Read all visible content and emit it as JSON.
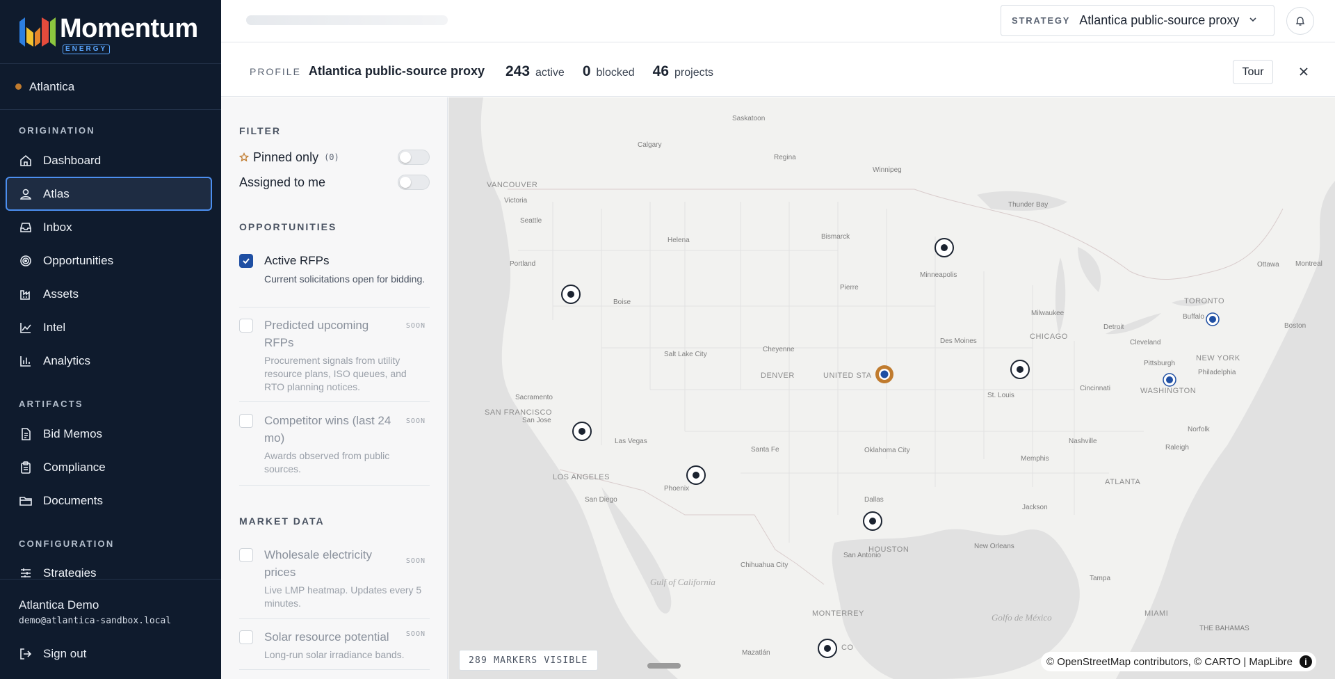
{
  "brand": {
    "name": "Momentum",
    "sub": "ENERGY"
  },
  "org": {
    "name": "Atlantica"
  },
  "nav": {
    "origination_title": "ORIGINATION",
    "origination": [
      {
        "label": "Dashboard",
        "icon": "home-icon"
      },
      {
        "label": "Atlas",
        "icon": "user-pin-icon",
        "active": true
      },
      {
        "label": "Inbox",
        "icon": "inbox-icon"
      },
      {
        "label": "Opportunities",
        "icon": "target-icon"
      },
      {
        "label": "Assets",
        "icon": "factory-icon"
      },
      {
        "label": "Intel",
        "icon": "trend-icon"
      },
      {
        "label": "Analytics",
        "icon": "bar-chart-icon"
      }
    ],
    "artifacts_title": "ARTIFACTS",
    "artifacts": [
      {
        "label": "Bid Memos",
        "icon": "document-icon"
      },
      {
        "label": "Compliance",
        "icon": "clipboard-icon"
      },
      {
        "label": "Documents",
        "icon": "folder-icon"
      }
    ],
    "configuration_title": "CONFIGURATION",
    "configuration": [
      {
        "label": "Strategies",
        "icon": "sliders-icon"
      }
    ]
  },
  "user": {
    "name": "Atlantica Demo",
    "email": "demo@atlantica-sandbox.local",
    "signout": "Sign out"
  },
  "topbar": {
    "strategy_label": "STRATEGY",
    "strategy_value": "Atlantica public-source proxy"
  },
  "profile": {
    "label": "PROFILE",
    "name": "Atlantica public-source proxy",
    "stats": [
      {
        "num": "243",
        "label": "active"
      },
      {
        "num": "0",
        "label": "blocked"
      },
      {
        "num": "46",
        "label": "projects"
      }
    ],
    "tour": "Tour"
  },
  "filter": {
    "title": "FILTER",
    "pinned_label": "Pinned only",
    "pinned_count": "(0)",
    "assigned_label": "Assigned to me"
  },
  "opportunities": {
    "title": "OPPORTUNITIES",
    "items": [
      {
        "title": "Active RFPs",
        "desc": "Current solicitations open for bidding.",
        "checked": true,
        "soon": ""
      },
      {
        "title": "Predicted upcoming RFPs",
        "desc": "Procurement signals from utility resource plans, ISO queues, and RTO planning notices.",
        "checked": false,
        "soon": "SOON"
      },
      {
        "title": "Competitor wins (last 24 mo)",
        "desc": "Awards observed from public sources.",
        "checked": false,
        "soon": "SOON"
      }
    ]
  },
  "market": {
    "title": "MARKET DATA",
    "items": [
      {
        "title": "Wholesale electricity prices",
        "desc": "Live LMP heatmap. Updates every 5 minutes.",
        "soon": "SOON"
      },
      {
        "title": "Solar resource potential",
        "desc": "Long-run solar irradiance bands.",
        "soon": "SOON"
      }
    ]
  },
  "map": {
    "markers_visible": "289 MARKERS VISIBLE",
    "attribution": "© OpenStreetMap contributors, © CARTO | MapLibre",
    "info": "i",
    "labels": {
      "saskatoon": "Saskatoon",
      "calgary": "Calgary",
      "regina": "Regina",
      "winnipeg": "Winnipeg",
      "vancouver": "VANCOUVER",
      "victoria": "Victoria",
      "seattle": "Seattle",
      "portland": "Portland",
      "thunder_bay": "Thunder Bay",
      "helena": "Helena",
      "bismarck": "Bismarck",
      "minneapolis": "Minneapolis",
      "ottawa": "Ottawa",
      "montreal": "Montreal",
      "boise": "Boise",
      "pierre": "Pierre",
      "toronto": "TORONTO",
      "milwaukee": "Milwaukee",
      "buffalo": "Buffalo",
      "boston": "Boston",
      "detroit": "Detroit",
      "chicago": "CHICAGO",
      "cleveland": "Cleveland",
      "des_moines": "Des Moines",
      "new_york": "NEW YORK",
      "salt_lake": "Salt Lake City",
      "cheyenne": "Cheyenne",
      "pittsburgh": "Pittsburgh",
      "philadelphia": "Philadelphia",
      "denver": "DENVER",
      "united_states": "UNITED STA",
      "washington": "WASHINGTON",
      "sacramento": "Sacramento",
      "cincinnati": "Cincinnati",
      "st_louis": "St. Louis",
      "san_francisco": "SAN FRANCISCO",
      "san_jose": "San Jose",
      "norfolk": "Norfolk",
      "las_vegas": "Las Vegas",
      "nashville": "Nashville",
      "santa_fe": "Santa Fe",
      "raleigh": "Raleigh",
      "oklahoma_city": "Oklahoma City",
      "memphis": "Memphis",
      "los_angeles": "LOS ANGELES",
      "atlanta": "ATLANTA",
      "phoenix": "Phoenix",
      "san_diego": "San Diego",
      "dallas": "Dallas",
      "jackson": "Jackson",
      "new_orleans": "New Orleans",
      "houston": "HOUSTON",
      "san_antonio": "San Antonio",
      "chihuahua": "Chihuahua City",
      "gulf_california": "Gulf of California",
      "tampa": "Tampa",
      "monterrey": "MONTERREY",
      "miami": "MIAMI",
      "golfo": "Golfo de México",
      "bahamas": "THE BAHAMAS",
      "mazatlan": "Mazatlán",
      "mexico": "CO"
    }
  }
}
